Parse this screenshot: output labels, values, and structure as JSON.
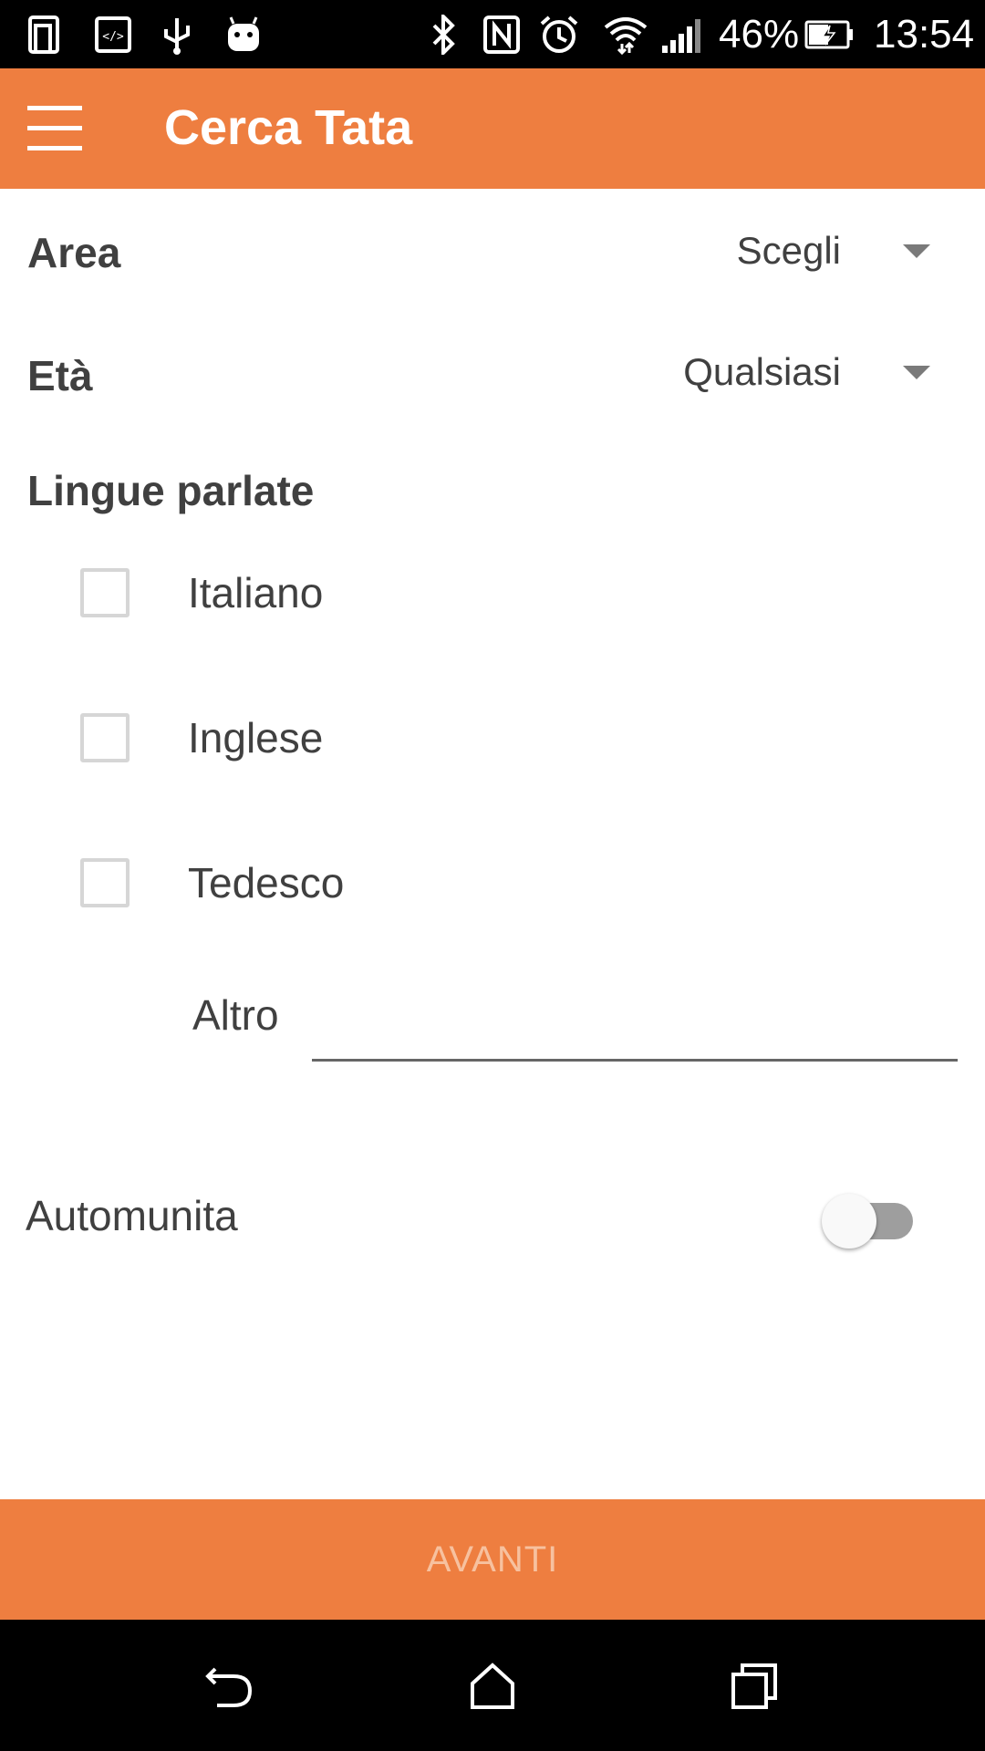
{
  "colors": {
    "accent": "#EE7E40",
    "status_bar": "#000000",
    "nav_bar": "#000000",
    "button_text_disabled": "#F7C19F",
    "toggle_track_off": "#9E9E9E"
  },
  "status_bar": {
    "battery_percent": "46%",
    "time": "13:54",
    "icons": [
      "phone-tablet-icon",
      "developer-code-icon",
      "usb-icon",
      "android-icon",
      "bluetooth-icon",
      "nfc-icon",
      "alarm-icon",
      "wifi-icon",
      "signal-icon",
      "battery-charging-icon"
    ]
  },
  "app_bar": {
    "title": "Cerca Tata",
    "menu_icon": "hamburger-menu-icon"
  },
  "form": {
    "area": {
      "label": "Area",
      "selected": "Scegli"
    },
    "age": {
      "label": "Età",
      "selected": "Qualsiasi"
    },
    "languages": {
      "label": "Lingue parlate",
      "options": [
        {
          "label": "Italiano",
          "checked": false
        },
        {
          "label": "Inglese",
          "checked": false
        },
        {
          "label": "Tedesco",
          "checked": false
        }
      ],
      "other": {
        "label": "Altro",
        "value": ""
      }
    },
    "car": {
      "label": "Automunita",
      "on": false
    }
  },
  "next_button": {
    "label": "AVANTI",
    "enabled": false
  },
  "nav_bar": {
    "icons": [
      "back-icon",
      "home-icon",
      "recents-icon"
    ]
  }
}
